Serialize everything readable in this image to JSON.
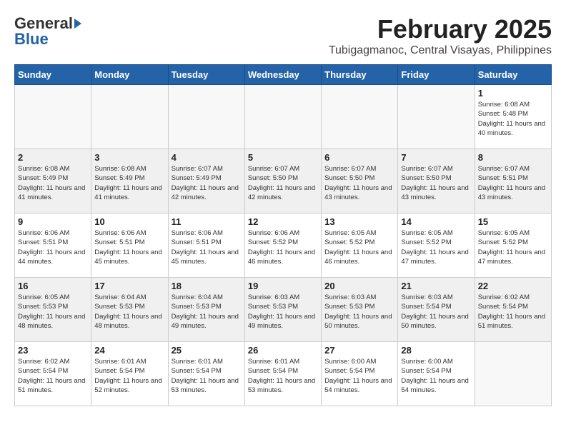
{
  "header": {
    "logo_general": "General",
    "logo_blue": "Blue",
    "month_year": "February 2025",
    "location": "Tubigagmanoc, Central Visayas, Philippines"
  },
  "weekdays": [
    "Sunday",
    "Monday",
    "Tuesday",
    "Wednesday",
    "Thursday",
    "Friday",
    "Saturday"
  ],
  "weeks": [
    [
      {
        "day": "",
        "info": ""
      },
      {
        "day": "",
        "info": ""
      },
      {
        "day": "",
        "info": ""
      },
      {
        "day": "",
        "info": ""
      },
      {
        "day": "",
        "info": ""
      },
      {
        "day": "",
        "info": ""
      },
      {
        "day": "1",
        "info": "Sunrise: 6:08 AM\nSunset: 5:48 PM\nDaylight: 11 hours\nand 40 minutes."
      }
    ],
    [
      {
        "day": "2",
        "info": "Sunrise: 6:08 AM\nSunset: 5:49 PM\nDaylight: 11 hours\nand 41 minutes."
      },
      {
        "day": "3",
        "info": "Sunrise: 6:08 AM\nSunset: 5:49 PM\nDaylight: 11 hours\nand 41 minutes."
      },
      {
        "day": "4",
        "info": "Sunrise: 6:07 AM\nSunset: 5:49 PM\nDaylight: 11 hours\nand 42 minutes."
      },
      {
        "day": "5",
        "info": "Sunrise: 6:07 AM\nSunset: 5:50 PM\nDaylight: 11 hours\nand 42 minutes."
      },
      {
        "day": "6",
        "info": "Sunrise: 6:07 AM\nSunset: 5:50 PM\nDaylight: 11 hours\nand 43 minutes."
      },
      {
        "day": "7",
        "info": "Sunrise: 6:07 AM\nSunset: 5:50 PM\nDaylight: 11 hours\nand 43 minutes."
      },
      {
        "day": "8",
        "info": "Sunrise: 6:07 AM\nSunset: 5:51 PM\nDaylight: 11 hours\nand 43 minutes."
      }
    ],
    [
      {
        "day": "9",
        "info": "Sunrise: 6:06 AM\nSunset: 5:51 PM\nDaylight: 11 hours\nand 44 minutes."
      },
      {
        "day": "10",
        "info": "Sunrise: 6:06 AM\nSunset: 5:51 PM\nDaylight: 11 hours\nand 45 minutes."
      },
      {
        "day": "11",
        "info": "Sunrise: 6:06 AM\nSunset: 5:51 PM\nDaylight: 11 hours\nand 45 minutes."
      },
      {
        "day": "12",
        "info": "Sunrise: 6:06 AM\nSunset: 5:52 PM\nDaylight: 11 hours\nand 46 minutes."
      },
      {
        "day": "13",
        "info": "Sunrise: 6:05 AM\nSunset: 5:52 PM\nDaylight: 11 hours\nand 46 minutes."
      },
      {
        "day": "14",
        "info": "Sunrise: 6:05 AM\nSunset: 5:52 PM\nDaylight: 11 hours\nand 47 minutes."
      },
      {
        "day": "15",
        "info": "Sunrise: 6:05 AM\nSunset: 5:52 PM\nDaylight: 11 hours\nand 47 minutes."
      }
    ],
    [
      {
        "day": "16",
        "info": "Sunrise: 6:05 AM\nSunset: 5:53 PM\nDaylight: 11 hours\nand 48 minutes."
      },
      {
        "day": "17",
        "info": "Sunrise: 6:04 AM\nSunset: 5:53 PM\nDaylight: 11 hours\nand 48 minutes."
      },
      {
        "day": "18",
        "info": "Sunrise: 6:04 AM\nSunset: 5:53 PM\nDaylight: 11 hours\nand 49 minutes."
      },
      {
        "day": "19",
        "info": "Sunrise: 6:03 AM\nSunset: 5:53 PM\nDaylight: 11 hours\nand 49 minutes."
      },
      {
        "day": "20",
        "info": "Sunrise: 6:03 AM\nSunset: 5:53 PM\nDaylight: 11 hours\nand 50 minutes."
      },
      {
        "day": "21",
        "info": "Sunrise: 6:03 AM\nSunset: 5:54 PM\nDaylight: 11 hours\nand 50 minutes."
      },
      {
        "day": "22",
        "info": "Sunrise: 6:02 AM\nSunset: 5:54 PM\nDaylight: 11 hours\nand 51 minutes."
      }
    ],
    [
      {
        "day": "23",
        "info": "Sunrise: 6:02 AM\nSunset: 5:54 PM\nDaylight: 11 hours\nand 51 minutes."
      },
      {
        "day": "24",
        "info": "Sunrise: 6:01 AM\nSunset: 5:54 PM\nDaylight: 11 hours\nand 52 minutes."
      },
      {
        "day": "25",
        "info": "Sunrise: 6:01 AM\nSunset: 5:54 PM\nDaylight: 11 hours\nand 53 minutes."
      },
      {
        "day": "26",
        "info": "Sunrise: 6:01 AM\nSunset: 5:54 PM\nDaylight: 11 hours\nand 53 minutes."
      },
      {
        "day": "27",
        "info": "Sunrise: 6:00 AM\nSunset: 5:54 PM\nDaylight: 11 hours\nand 54 minutes."
      },
      {
        "day": "28",
        "info": "Sunrise: 6:00 AM\nSunset: 5:54 PM\nDaylight: 11 hours\nand 54 minutes."
      },
      {
        "day": "",
        "info": ""
      }
    ]
  ]
}
